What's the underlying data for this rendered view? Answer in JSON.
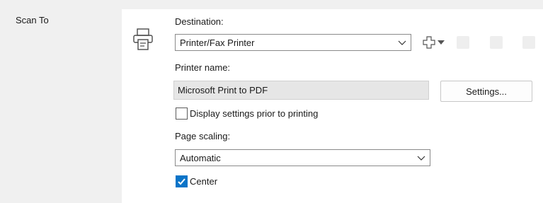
{
  "section": {
    "label": "Scan To"
  },
  "destination": {
    "label": "Destination:",
    "value": "Printer/Fax Printer"
  },
  "toolbar": {
    "icons": [
      "add-icon",
      "dropdown-arrow-icon",
      "disabled-icon",
      "disabled-icon",
      "disabled-icon"
    ]
  },
  "printer_name": {
    "label": "Printer name:",
    "value": "Microsoft Print to PDF"
  },
  "settings_button": {
    "label": "Settings..."
  },
  "display_settings": {
    "label": "Display settings prior to printing",
    "checked": false
  },
  "page_scaling": {
    "label": "Page scaling:",
    "value": "Automatic"
  },
  "center": {
    "label": "Center",
    "checked": true
  },
  "colors": {
    "accent": "#0a74c8",
    "panel": "#ffffff",
    "background": "#f0f0f0"
  }
}
